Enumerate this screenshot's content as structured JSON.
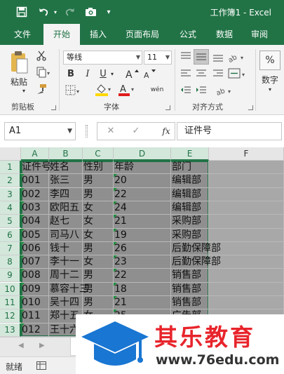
{
  "window": {
    "title": "工作簿1 - Excel"
  },
  "ribbon": {
    "tabs": [
      {
        "label": "文件"
      },
      {
        "label": "开始"
      },
      {
        "label": "插入"
      },
      {
        "label": "页面布局"
      },
      {
        "label": "公式"
      },
      {
        "label": "数据"
      },
      {
        "label": "审阅"
      }
    ],
    "active_tab": "开始",
    "clipboard": {
      "paste_label": "粘贴",
      "group_label": "剪贴板"
    },
    "font": {
      "font_name": "等线",
      "font_size": "11",
      "bold": "B",
      "italic": "I",
      "underline": "U",
      "phonetic": "wén",
      "group_label": "字体"
    },
    "alignment": {
      "group_label": "对齐方式"
    },
    "number": {
      "percent": "%",
      "label": "数字"
    }
  },
  "formula_bar": {
    "name_box": "A1",
    "cancel": "✕",
    "enter": "✓",
    "fx": "fx",
    "value": "证件号"
  },
  "grid": {
    "columns": [
      "A",
      "B",
      "C",
      "D",
      "E",
      "F"
    ],
    "selected_columns": [
      "A",
      "B",
      "C",
      "D",
      "E"
    ],
    "rows": [
      "1",
      "2",
      "3",
      "4",
      "5",
      "6",
      "7",
      "8",
      "9",
      "10",
      "11",
      "12",
      "13"
    ],
    "data": [
      [
        "证件号",
        "姓名",
        "性别",
        "年龄",
        "部门"
      ],
      [
        "001",
        "张三",
        "男",
        "20",
        "编辑部"
      ],
      [
        "002",
        "李四",
        "男",
        "22",
        "编辑部"
      ],
      [
        "003",
        "欧阳五",
        "女",
        "24",
        "编辑部"
      ],
      [
        "004",
        "赵七",
        "女",
        "21",
        "采购部"
      ],
      [
        "005",
        "司马八",
        "女",
        "19",
        "采购部"
      ],
      [
        "006",
        "钱十",
        "男",
        "26",
        "后勤保障部"
      ],
      [
        "007",
        "李十一",
        "女",
        "23",
        "后勤保障部"
      ],
      [
        "008",
        "周十二",
        "男",
        "22",
        "销售部"
      ],
      [
        "009",
        "慕容十三",
        "男",
        "18",
        "销售部"
      ],
      [
        "010",
        "吴十四",
        "男",
        "21",
        "销售部"
      ],
      [
        "011",
        "郑十五",
        "女",
        "25",
        "广告部"
      ],
      [
        "012",
        "王十六",
        "",
        "",
        ""
      ]
    ]
  },
  "status_bar": {
    "ready": "就绪"
  },
  "watermark": {
    "title": "其乐教育",
    "url": "www.76edu.com",
    "logo_color": "#1976d2",
    "title_color": "#e8242b"
  },
  "colors": {
    "accent": "#217346",
    "selection": "#8f8f8f"
  }
}
